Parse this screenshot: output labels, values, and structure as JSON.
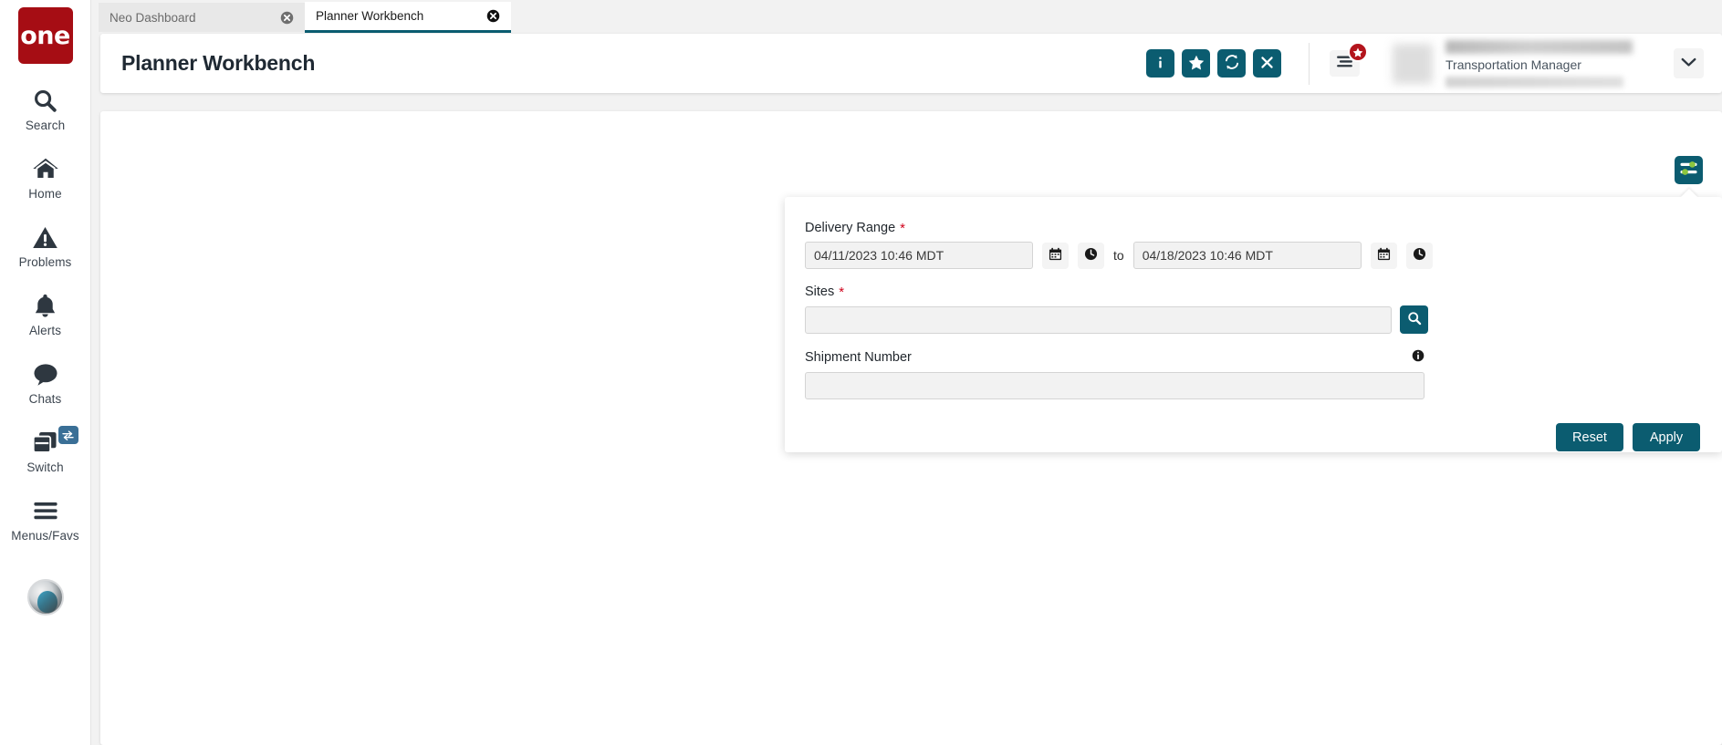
{
  "brand": {
    "logo_text": "one",
    "logo_color": "#a60d14"
  },
  "theme": {
    "accent": "#0b5c70",
    "required_star": "#d0021b",
    "badge_red": "#b3141c"
  },
  "sidebar": {
    "items": [
      {
        "label": "Search",
        "icon": "search-icon"
      },
      {
        "label": "Home",
        "icon": "home-icon"
      },
      {
        "label": "Problems",
        "icon": "warning-triangle-icon"
      },
      {
        "label": "Alerts",
        "icon": "bell-icon"
      },
      {
        "label": "Chats",
        "icon": "chat-bubble-icon"
      },
      {
        "label": "Switch",
        "icon": "windows-stack-icon"
      },
      {
        "label": "Menus/Favs",
        "icon": "hamburger-icon"
      }
    ]
  },
  "tabs": [
    {
      "label": "Neo Dashboard",
      "active": false
    },
    {
      "label": "Planner Workbench",
      "active": true
    }
  ],
  "header": {
    "title": "Planner Workbench",
    "actions": [
      {
        "name": "info-button",
        "icon": "info-icon",
        "label": "i"
      },
      {
        "name": "favorite-button",
        "icon": "star-icon",
        "label": "★"
      },
      {
        "name": "refresh-button",
        "icon": "refresh-icon",
        "label": "⟳"
      },
      {
        "name": "close-button",
        "icon": "close-icon",
        "label": "✕"
      }
    ],
    "user": {
      "role": "Transportation Manager"
    }
  },
  "filter_panel": {
    "delivery_range": {
      "label": "Delivery Range",
      "required": true,
      "from_value": "04/11/2023 10:46 MDT",
      "to_value": "04/18/2023 10:46 MDT",
      "separator": "to"
    },
    "sites": {
      "label": "Sites",
      "required": true,
      "value": ""
    },
    "shipment_number": {
      "label": "Shipment Number",
      "required": false,
      "value": ""
    },
    "reset_label": "Reset",
    "apply_label": "Apply"
  }
}
